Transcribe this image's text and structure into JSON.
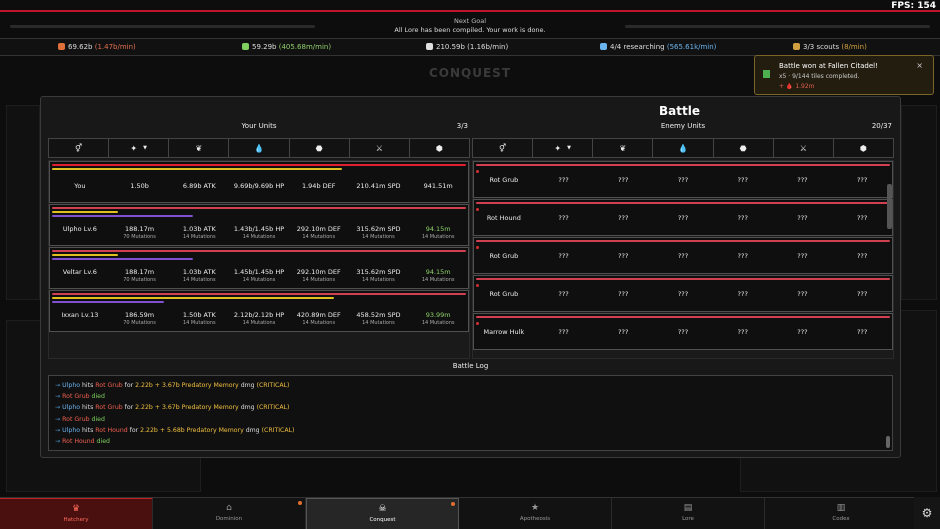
{
  "fps": "FPS: 154",
  "goal": {
    "title": "Next Goal",
    "text": "All Lore has been compiled. Your work is done."
  },
  "resources": [
    {
      "value": "69.62b",
      "rate": "(1.47b/min)",
      "icon": "flame-icon",
      "color": "#e0703a",
      "rate_color": "#e07050"
    },
    {
      "value": "59.29b",
      "rate": "(405.68m/min)",
      "icon": "leaf-icon",
      "color": "#7fd060",
      "rate_color": "#8fd06a"
    },
    {
      "value": "210.59b",
      "rate": "(1.16b/min)",
      "icon": "drop-icon",
      "color": "#e0e0e0",
      "rate_color": "#dddddd"
    },
    {
      "value": "4/4 researching",
      "rate": "(565.61k/min)",
      "icon": "research-icon",
      "color": "#6ab4f0",
      "rate_color": "#6ab4f0"
    },
    {
      "value": "3/3 scouts",
      "rate": "(8/min)",
      "icon": "scout-icon",
      "color": "#d0a040",
      "rate_color": "#d0a040"
    }
  ],
  "background": {
    "title": "CONQUEST"
  },
  "toast": {
    "title": "Battle won at Fallen Citadel!",
    "sub": "x5 · 9/144 tiles completed.",
    "reward": "+ 🩸 1.92m",
    "close": "×"
  },
  "battle": {
    "title": "Battle",
    "your_units": {
      "title": "Your Units",
      "count": "3/3",
      "headers": [
        "⚥",
        "✦",
        "❦",
        "💧",
        "⬣",
        "⚔",
        "⬢"
      ],
      "rows": [
        {
          "name": "You",
          "cells": [
            "1.50b",
            "6.89b ATK",
            "9.69b/9.69b HP",
            "1.94b DEF",
            "210.41m SPD",
            "941.51m"
          ],
          "subs": [
            "",
            "",
            "",
            "",
            "",
            ""
          ],
          "bars": [
            {
              "color": "#e02030",
              "pct": 100
            },
            {
              "color": "#e0c020",
              "pct": 70
            }
          ]
        },
        {
          "name": "Ulpho Lv.6",
          "cells": [
            "188.17m",
            "1.03b ATK",
            "1.43b/1.45b HP",
            "292.10m DEF",
            "315.62m SPD",
            "94.15m"
          ],
          "subs": [
            "70 Mutations",
            "14 Mutations",
            "14 Mutations",
            "14 Mutations",
            "14 Mutations",
            "14 Mutations"
          ],
          "bars": [
            {
              "color": "#d04050",
              "pct": 100
            },
            {
              "color": "#e0c020",
              "pct": 16
            },
            {
              "color": "#8050d0",
              "pct": 34
            }
          ]
        },
        {
          "name": "Veltar Lv.6",
          "cells": [
            "188.17m",
            "1.03b ATK",
            "1.45b/1.45b HP",
            "292.10m DEF",
            "315.62m SPD",
            "94.15m"
          ],
          "subs": [
            "70 Mutations",
            "14 Mutations",
            "14 Mutations",
            "14 Mutations",
            "14 Mutations",
            "14 Mutations"
          ],
          "bars": [
            {
              "color": "#d04050",
              "pct": 100
            },
            {
              "color": "#e0c020",
              "pct": 16
            },
            {
              "color": "#8050d0",
              "pct": 34
            }
          ]
        },
        {
          "name": "Ixxan Lv.13",
          "cells": [
            "186.59m",
            "1.50b ATK",
            "2.12b/2.12b HP",
            "420.89m DEF",
            "458.52m SPD",
            "93.99m"
          ],
          "subs": [
            "70 Mutations",
            "14 Mutations",
            "14 Mutations",
            "14 Mutations",
            "14 Mutations",
            "14 Mutations"
          ],
          "bars": [
            {
              "color": "#d04050",
              "pct": 100
            },
            {
              "color": "#e0c020",
              "pct": 68
            },
            {
              "color": "#8050d0",
              "pct": 27
            }
          ]
        }
      ]
    },
    "enemy_units": {
      "title": "Enemy Units",
      "count": "20/37",
      "headers": [
        "⚥",
        "✦",
        "❦",
        "💧",
        "⬣",
        "⚔",
        "⬢"
      ],
      "rows": [
        {
          "name": "Rot Grub",
          "cells": [
            "???",
            "???",
            "???",
            "???",
            "???",
            "???"
          ]
        },
        {
          "name": "Rot Hound",
          "cells": [
            "???",
            "???",
            "???",
            "???",
            "???",
            "???"
          ]
        },
        {
          "name": "Rot Grub",
          "cells": [
            "???",
            "???",
            "???",
            "???",
            "???",
            "???"
          ]
        },
        {
          "name": "Rot Grub",
          "cells": [
            "???",
            "???",
            "???",
            "???",
            "???",
            "???"
          ]
        },
        {
          "name": "Marrow Hulk",
          "cells": [
            "???",
            "???",
            "???",
            "???",
            "???",
            "???"
          ]
        }
      ]
    },
    "log": {
      "title": "Battle Log",
      "lines": [
        [
          {
            "t": "→ ",
            "c": "arrow"
          },
          {
            "t": "Ulpho",
            "c": "c-blue"
          },
          {
            "t": " hits "
          },
          {
            "t": "Rot Grub",
            "c": "c-red"
          },
          {
            "t": " for "
          },
          {
            "t": "2.22b + 3.67b Predatory Memory",
            "c": "c-yel"
          },
          {
            "t": " dmg "
          },
          {
            "t": "(CRITICAL)",
            "c": "c-yel"
          }
        ],
        [
          {
            "t": "→ ",
            "c": "arrow"
          },
          {
            "t": "Rot Grub",
            "c": "c-red"
          },
          {
            "t": " died",
            "c": "c-green"
          }
        ],
        [
          {
            "t": "→ ",
            "c": "arrow"
          },
          {
            "t": "Ulpho",
            "c": "c-blue"
          },
          {
            "t": " hits "
          },
          {
            "t": "Rot Grub",
            "c": "c-red"
          },
          {
            "t": " for "
          },
          {
            "t": "2.22b + 3.67b Predatory Memory",
            "c": "c-yel"
          },
          {
            "t": " dmg "
          },
          {
            "t": "(CRITICAL)",
            "c": "c-yel"
          }
        ],
        [
          {
            "t": "→ ",
            "c": "arrow"
          },
          {
            "t": "Rot Grub",
            "c": "c-red"
          },
          {
            "t": " died",
            "c": "c-green"
          }
        ],
        [
          {
            "t": "→ ",
            "c": "arrow"
          },
          {
            "t": "Ulpho",
            "c": "c-blue"
          },
          {
            "t": " hits "
          },
          {
            "t": "Rot Hound",
            "c": "c-red"
          },
          {
            "t": " for "
          },
          {
            "t": "2.22b + 5.68b Predatory Memory",
            "c": "c-yel"
          },
          {
            "t": " dmg "
          },
          {
            "t": "(CRITICAL)",
            "c": "c-yel"
          }
        ],
        [
          {
            "t": "→ ",
            "c": "arrow"
          },
          {
            "t": "Rot Hound",
            "c": "c-red"
          },
          {
            "t": " died",
            "c": "c-green"
          }
        ]
      ]
    }
  },
  "nav": [
    {
      "label": "Hatchery",
      "icon": "crown-icon",
      "glyph": "♛",
      "state": "hatch",
      "dot": false
    },
    {
      "label": "Dominion",
      "icon": "home-icon",
      "glyph": "⌂",
      "state": "",
      "dot": true
    },
    {
      "label": "Conquest",
      "icon": "skull-icon",
      "glyph": "☠",
      "state": "active",
      "dot": true
    },
    {
      "label": "Apotheosis",
      "icon": "star-icon",
      "glyph": "★",
      "state": "",
      "dot": false
    },
    {
      "label": "Lore",
      "icon": "book-icon",
      "glyph": "▤",
      "state": "",
      "dot": false
    },
    {
      "label": "Codex",
      "icon": "codex-icon",
      "glyph": "▥",
      "state": "",
      "dot": false
    }
  ],
  "settings_icon": "gear-icon"
}
